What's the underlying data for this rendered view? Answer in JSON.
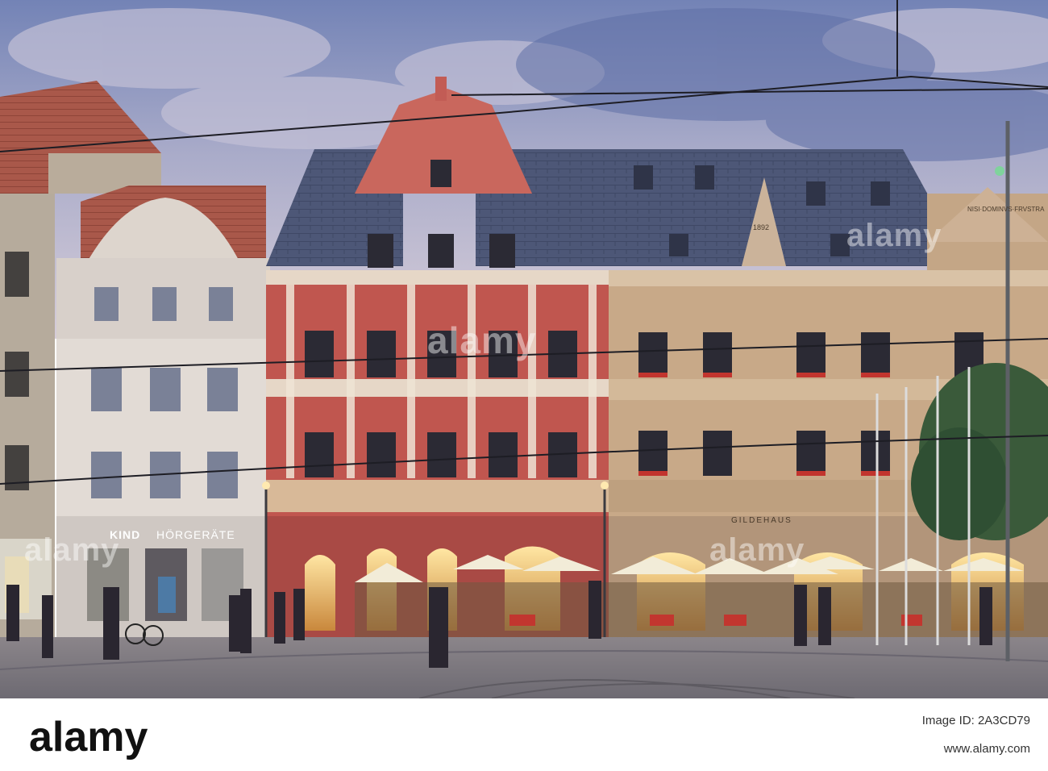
{
  "signs": {
    "kind": "KIND",
    "hoergeraete": "HÖRGERÄTE",
    "gildehaus": "GILDEHAUS",
    "year": "1892",
    "inscription": "NISI·DOMINVS·FRVSTRA"
  },
  "watermark": {
    "logo": "alamy"
  },
  "footer": {
    "logo": "alamy",
    "image_id_label": "Image ID: 2A3CD79",
    "url": "www.alamy.com"
  },
  "colors": {
    "sky_top": "#6f7fb4",
    "sky_bottom": "#c9c3d8",
    "roof": "#4d5777",
    "red_facade": "#b9524c",
    "sand_facade": "#c7a987",
    "cream_facade": "#e4ddd6",
    "pavement": "#7e7a80"
  }
}
